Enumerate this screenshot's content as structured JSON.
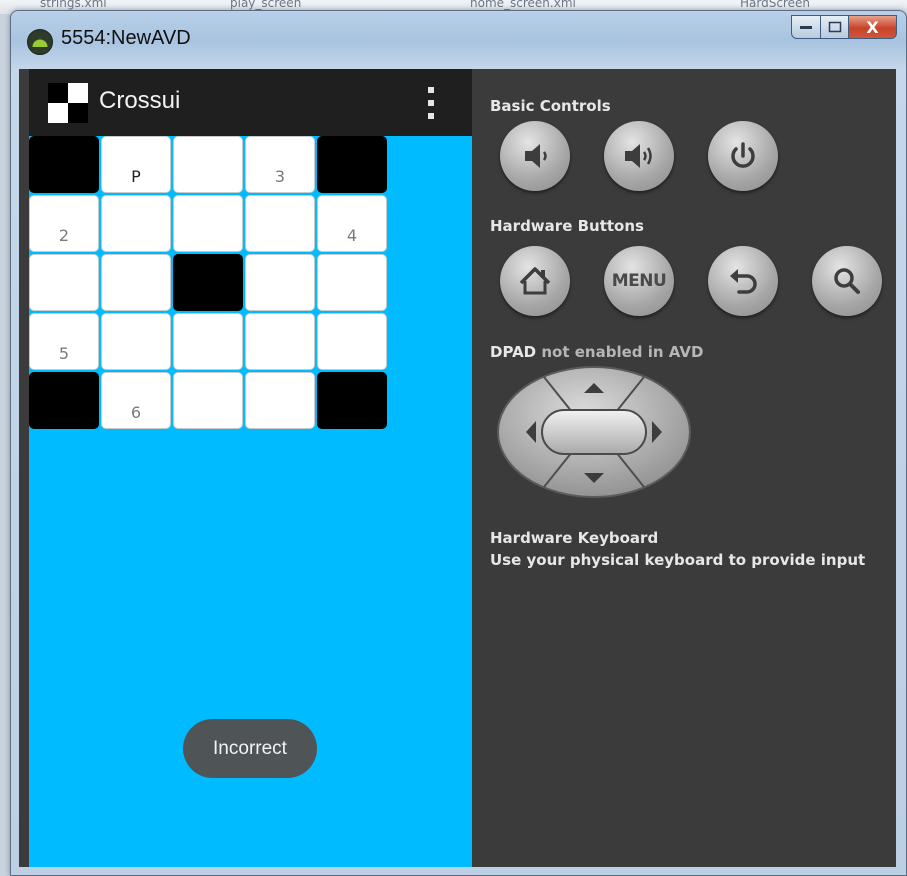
{
  "window": {
    "title": "5554:NewAVD",
    "close_glyph": "X"
  },
  "app": {
    "name": "Crossui"
  },
  "grid": {
    "rows": [
      [
        {
          "type": "black"
        },
        {
          "type": "white",
          "text": "P",
          "letter": true
        },
        {
          "type": "white"
        },
        {
          "type": "white",
          "text": "3"
        },
        {
          "type": "black"
        }
      ],
      [
        {
          "type": "white",
          "text": "2"
        },
        {
          "type": "white"
        },
        {
          "type": "white"
        },
        {
          "type": "white"
        },
        {
          "type": "white",
          "text": "4"
        }
      ],
      [
        {
          "type": "white"
        },
        {
          "type": "white"
        },
        {
          "type": "black"
        },
        {
          "type": "white"
        },
        {
          "type": "white"
        }
      ],
      [
        {
          "type": "white",
          "text": "5"
        },
        {
          "type": "white"
        },
        {
          "type": "white"
        },
        {
          "type": "white"
        },
        {
          "type": "white"
        }
      ],
      [
        {
          "type": "black"
        },
        {
          "type": "white",
          "text": "6"
        },
        {
          "type": "white"
        },
        {
          "type": "white"
        },
        {
          "type": "black"
        }
      ]
    ]
  },
  "toast": {
    "text": "Incorrect"
  },
  "controls": {
    "basic_title": "Basic Controls",
    "basic": [
      "volume-down-icon",
      "volume-up-icon",
      "power-icon"
    ],
    "hardware_title": "Hardware Buttons",
    "hardware": [
      "home-icon",
      "menu-button",
      "back-icon",
      "search-icon"
    ],
    "menu_label": "MENU",
    "dpad_title_bold": "DPAD",
    "dpad_title_rest": " not enabled in AVD",
    "keyboard_title": "Hardware Keyboard",
    "keyboard_text": "Use your physical keyboard to provide input"
  },
  "colors": {
    "phone_bg": "#00bbff",
    "panel_bg": "#3b3b3b",
    "action_bar": "#1f1f1f",
    "toast_bg": "#4f5557"
  }
}
